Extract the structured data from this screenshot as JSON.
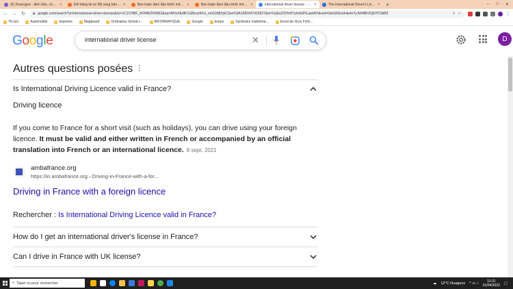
{
  "browser": {
    "tabs": [
      {
        "title": "(6) Dosesgon - diễn đàn, cộng c",
        "color": "#7b5cd6",
        "active": false
      },
      {
        "title": "Đổi bằng lái xe Mỹ sang bằng lá",
        "color": "#f06a25",
        "active": false
      },
      {
        "title": "Bọn bake đàm đảo kênh mồ 2 s",
        "color": "#f06a25",
        "active": false
      },
      {
        "title": "Bọn bake đàm đảo kênh mồ 2 s",
        "color": "#f06a25",
        "active": false
      },
      {
        "title": "international driver license - Re",
        "color": "#4285f4",
        "active": true
      },
      {
        "title": "The International Driver's Licens",
        "color": "#1a73e8",
        "active": false
      }
    ],
    "new_tab": "+",
    "url": "google.com/search?q=international+driver+license&rlz=1C1CHBF_frFR862FR862&oq=APwXEdfK1Gl8cxzhFsi_omOzMjYpiC3ue%3A1680347419527&ei=GsEsZOHnH7yrkdUPtLaekAY&ved=0ahUKEwih4p4vYj-AhWBVIQEHTSbB3",
    "bookmarks": [
      "Tin tức",
      "Automobile",
      "Importés",
      "Magboard",
      "Ordinateur format t...",
      "INFORMATIQUE",
      "Google",
      "temps",
      "Symboles mathéma...",
      "Envoi de Gros Fichi..."
    ]
  },
  "google": {
    "logo": "Google",
    "query": "international driver license",
    "avatar_initial": "D"
  },
  "paa": {
    "title": "Autres questions posées",
    "q1": "Is International Driving Licence valid in France?",
    "answer_heading": "Driving licence",
    "answer_plain": "If you come to France for a short visit (such as holidays), you can drive using your foreign licence. ",
    "answer_bold": "It must be valid and either written in French or accompanied by an official translation into French or an international licence.",
    "answer_date": "8 sept. 2021",
    "source_name": "ambafrance.org",
    "source_url": "https://in.ambafrance.org › Driving-in-France-with-a-for...",
    "link_title": "Driving in France with a foreign licence",
    "search_label": "Rechercher : ",
    "search_link": "Is International Driving Licence valid in France?",
    "q2": "How do I get an international driver's license in France?",
    "q3": "Can I drive in France with UK license?"
  },
  "taskbar": {
    "search_placeholder": "Taper ici pour rechercher",
    "weather": "12°C  Nuageux",
    "time": "13:31",
    "date": "01/04/2023"
  }
}
